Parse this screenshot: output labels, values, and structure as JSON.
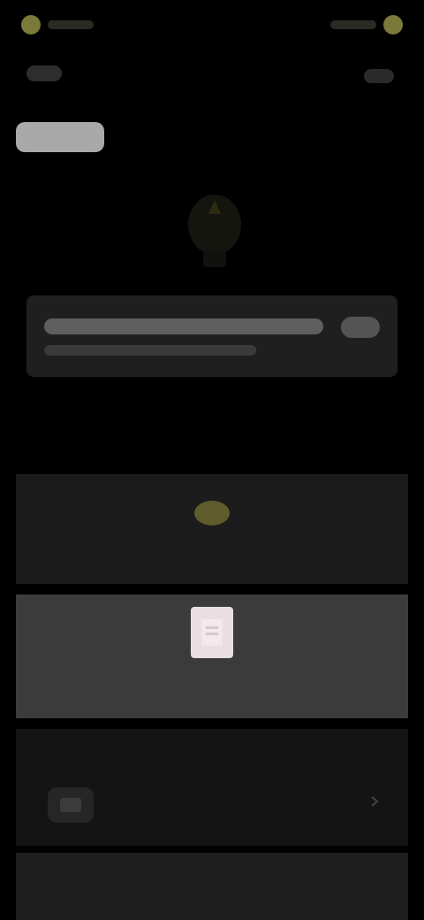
{
  "status": {
    "left_text": "",
    "right_text": ""
  },
  "header": {
    "back_label": ""
  },
  "hero": {
    "icon": "lightbulb-icon"
  },
  "banner": {
    "title": "",
    "subtitle": ""
  },
  "cards": {
    "card1": {
      "icon": "lightbulb-icon",
      "label": ""
    },
    "card2": {
      "icon": "document-icon",
      "label": ""
    },
    "card3": {
      "title": "",
      "left_icon": "device-icon",
      "right_icon": "chevron-right-icon"
    },
    "card4": {
      "title": ""
    }
  },
  "colors": {
    "background": "#000000",
    "accent": "#d6cf6f",
    "card_active": "#3b3b3b"
  }
}
